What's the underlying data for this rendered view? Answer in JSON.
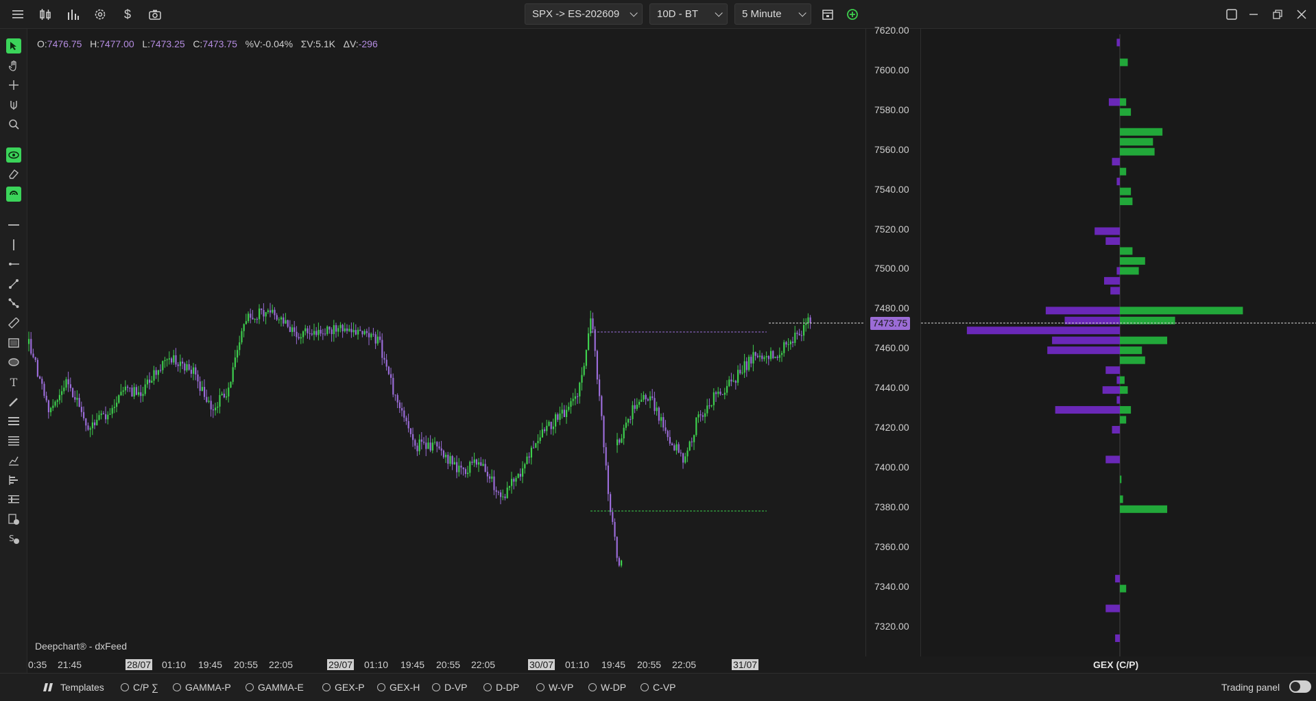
{
  "toolbar": {
    "symbol": "SPX -> ES-202609",
    "range": "10D - BT",
    "interval": "5 Minute"
  },
  "ohlc": {
    "open_label": "O:",
    "open": "7476.75",
    "high_label": "H:",
    "high": "7477.00",
    "low_label": "L:",
    "low": "7473.25",
    "close_label": "C:",
    "close": "7473.75",
    "pct_label": "%V:",
    "pct": "-0.04%",
    "sigma_label": "ΣV:",
    "sigma": "5.1K",
    "delta_label": "ΔV:",
    "delta": "-296"
  },
  "credit": "Deepchart® - dxFeed",
  "price_axis": [
    "7620.00",
    "7600.00",
    "7580.00",
    "7560.00",
    "7540.00",
    "7520.00",
    "7500.00",
    "7480.00",
    "7460.00",
    "7440.00",
    "7420.00",
    "7400.00",
    "7380.00",
    "7360.00",
    "7340.00",
    "7320.00"
  ],
  "current_price": "7473.75",
  "time_axis": [
    {
      "label": "0:35",
      "date": false
    },
    {
      "label": "21:45",
      "date": false
    },
    {
      "label": "28/07",
      "date": true
    },
    {
      "label": "01:10",
      "date": false
    },
    {
      "label": "19:45",
      "date": false
    },
    {
      "label": "20:55",
      "date": false
    },
    {
      "label": "22:05",
      "date": false
    },
    {
      "label": "29/07",
      "date": true
    },
    {
      "label": "01:10",
      "date": false
    },
    {
      "label": "19:45",
      "date": false
    },
    {
      "label": "20:55",
      "date": false
    },
    {
      "label": "22:05",
      "date": false
    },
    {
      "label": "30/07",
      "date": true
    },
    {
      "label": "01:10",
      "date": false
    },
    {
      "label": "19:45",
      "date": false
    },
    {
      "label": "20:55",
      "date": false
    },
    {
      "label": "22:05",
      "date": false
    },
    {
      "label": "31/07",
      "date": true
    }
  ],
  "gex_title": "GEX (C/P)",
  "bottom": {
    "templates": "Templates",
    "options": [
      "C/P ∑",
      "GAMMA-P",
      "GAMMA-E",
      "GEX-P",
      "GEX-H",
      "D-VP",
      "D-DP",
      "W-VP",
      "W-DP",
      "C-VP"
    ],
    "trading_panel": "Trading panel"
  },
  "colors": {
    "bull": "#3ecf4e",
    "bear": "#9a6cd8",
    "gex_call": "#22a83a",
    "gex_put": "#6a28b8",
    "accent": "#3bd45a"
  },
  "icons": {
    "top": [
      "menu-icon",
      "candlestick-icon",
      "bar-chart-icon",
      "settings-icon",
      "dollar-icon",
      "camera-icon"
    ],
    "left": [
      "pointer-icon",
      "hand-icon",
      "crosshair-icon",
      "magnet-icon",
      "zoom-icon",
      "eye-icon",
      "eraser-icon",
      "magnet-lock-icon",
      "horizontal-line-icon",
      "vertical-line-icon",
      "ray-icon",
      "trendline-icon",
      "path-icon",
      "ruler-icon",
      "rectangle-icon",
      "ellipse-icon",
      "text-icon",
      "pencil-icon",
      "list-icon",
      "list-dense-icon",
      "fib-icon",
      "volume-profile-icon",
      "layers-icon",
      "dollar-book-icon",
      "dollar-settings-icon"
    ]
  },
  "chart_data": {
    "type": "candlestick",
    "gex_levels": [
      {
        "price": 7500,
        "call": 12,
        "put": -2
      },
      {
        "price": 7480,
        "call": 78,
        "put": -47
      },
      {
        "price": 7475,
        "call": 35,
        "put": -35
      },
      {
        "price": 7470,
        "call": 0,
        "put": -97
      },
      {
        "price": 7465,
        "call": 30,
        "put": -43
      },
      {
        "price": 7460,
        "call": 14,
        "put": -46
      },
      {
        "price": 7430,
        "call": 7,
        "put": -41
      },
      {
        "price": 7380,
        "call": 30,
        "put": 0
      }
    ]
  }
}
